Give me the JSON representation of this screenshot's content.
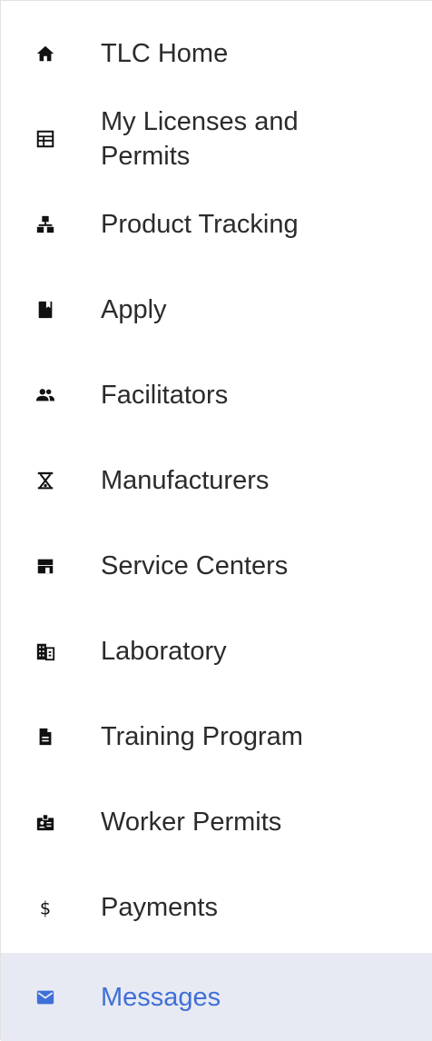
{
  "nav": {
    "accent_color": "#3f6fd8",
    "active_bg": "#e8eaf3",
    "items": [
      {
        "label": "TLC Home",
        "icon": "home-icon"
      },
      {
        "label": "My Licenses and Permits",
        "icon": "table-icon"
      },
      {
        "label": "Product Tracking",
        "icon": "sitemap-icon"
      },
      {
        "label": "Apply",
        "icon": "book-icon"
      },
      {
        "label": "Facilitators",
        "icon": "people-icon"
      },
      {
        "label": "Manufacturers",
        "icon": "scale-icon"
      },
      {
        "label": "Service Centers",
        "icon": "store-icon"
      },
      {
        "label": "Laboratory",
        "icon": "building-icon"
      },
      {
        "label": "Training Program",
        "icon": "document-icon"
      },
      {
        "label": "Worker Permits",
        "icon": "badge-icon"
      },
      {
        "label": "Payments",
        "icon": "dollar-icon"
      },
      {
        "label": "Messages",
        "icon": "mail-icon",
        "active": true
      }
    ]
  }
}
